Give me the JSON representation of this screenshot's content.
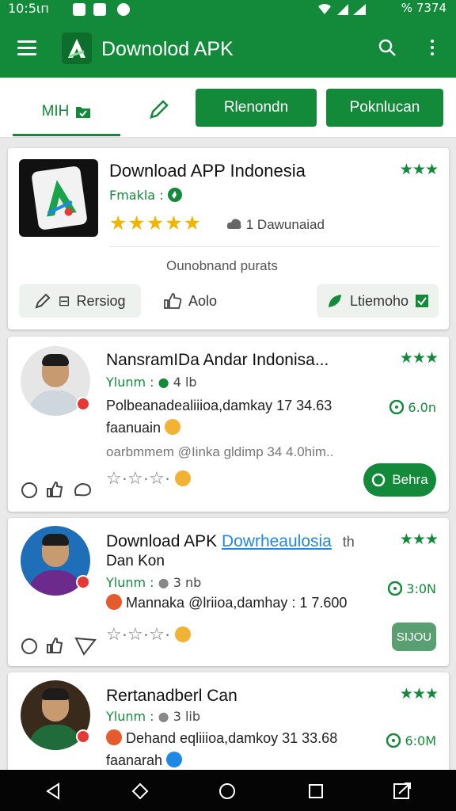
{
  "status_bar": {
    "time": "10:5ιп",
    "right_text": "%  7374"
  },
  "app_bar": {
    "title": "Downolod APK"
  },
  "tabs": {
    "first": "MIH",
    "pill1": "Rlenondn",
    "pill2": "Poknlucan"
  },
  "featured": {
    "title": "Download APP Indonesia",
    "subtitle": "Fmakla :",
    "downloads": "1  Dawunaiad",
    "caption": "Ounobnand purats",
    "action_left": "Rersiog",
    "action_mid": "Aolo",
    "action_right": "Ltiemoho"
  },
  "posts": [
    {
      "name": "NansramIDa Andar Indonisa...",
      "meta_label": "Ylunm :",
      "meta_value": "4 lb",
      "text": "Polbeanadealiiioa,damkay 17 34.63 faanuain",
      "subtext": "oarbmmem @Iinka gldimp 34 4.0him..",
      "time": "6.0n",
      "button": "Behra"
    },
    {
      "name": "Download APK",
      "name_link": "Dowrheaulosia",
      "name_tail": "th",
      "name_line2": "Dan Kon",
      "meta_label": "Ylunm :",
      "meta_value": "3 nb",
      "text": "Mannaka @lriioa,damhay : 1 7.600",
      "time": "3:0N",
      "button": "SIJOU"
    },
    {
      "name": "Rertanadberl Can",
      "meta_label": "Ylunm :",
      "meta_value": "3 lib",
      "text": "Dehand eqliiioa,damkoy 31 33.68 faanarah",
      "time": "6:0M"
    }
  ],
  "colors": {
    "brand": "#128a3a",
    "star": "#f3b400",
    "link": "#1e88e5"
  }
}
